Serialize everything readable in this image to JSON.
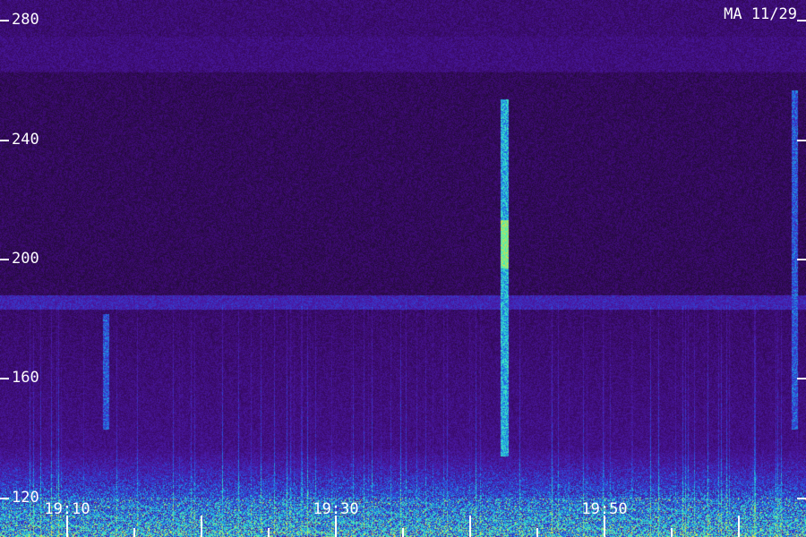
{
  "caption": "MA 11/29",
  "y_axis": {
    "ticks": [
      280,
      240,
      200,
      160,
      120
    ],
    "range": [
      107,
      287
    ]
  },
  "x_axis": {
    "labels": [
      "19:10",
      "19:30",
      "19:50"
    ],
    "start_minute": 1145,
    "end_minute": 1205
  },
  "colors": {
    "background": "#1a0a28",
    "text": "#ffffff",
    "colormap": [
      "#1a0a28",
      "#3a0a6a",
      "#4a1aa8",
      "#2850e0",
      "#20b0e0",
      "#40f0c0",
      "#e0e040"
    ]
  }
}
